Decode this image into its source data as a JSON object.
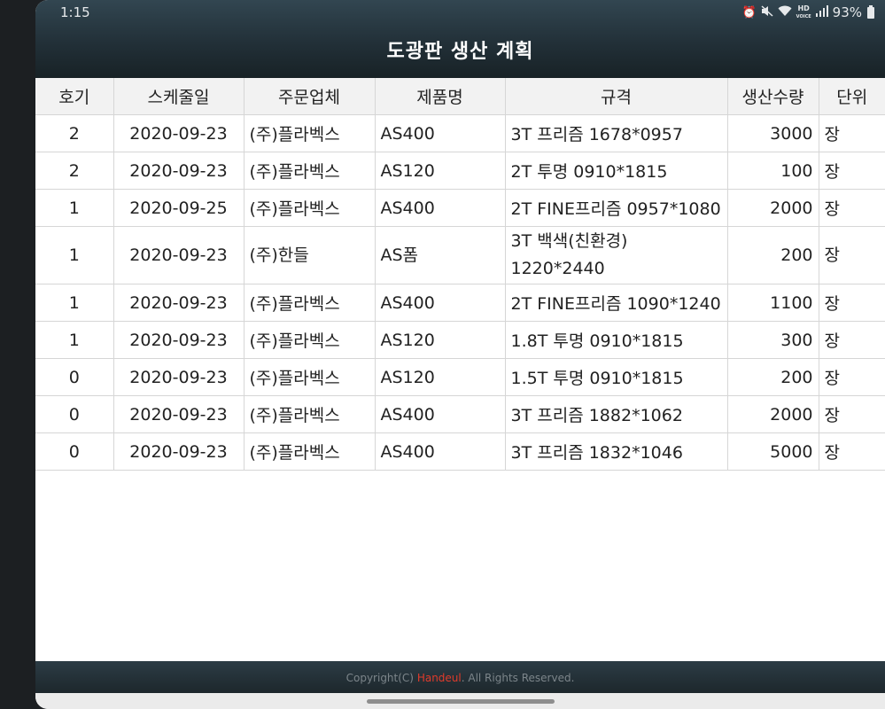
{
  "status": {
    "time": "1:15",
    "battery": "93%",
    "icons": [
      "alarm-icon",
      "mute-icon",
      "wifi-icon",
      "hd-voice-icon",
      "signal-icon",
      "battery-icon"
    ],
    "hd_top": "HD",
    "hd_bottom": "VOICE"
  },
  "header": {
    "title": "도광판 생산 계획"
  },
  "table": {
    "columns": [
      "호기",
      "스케줄일",
      "주문업체",
      "제품명",
      "규격",
      "생산수량",
      "단위"
    ],
    "rows": [
      {
        "machine": "2",
        "date": "2020-09-23",
        "company": "(주)플라벡스",
        "product": "AS400",
        "spec": "3T 프리즘 1678*0957",
        "qty": "3000",
        "unit": "장"
      },
      {
        "machine": "2",
        "date": "2020-09-23",
        "company": "(주)플라벡스",
        "product": "AS120",
        "spec": "2T 투명 0910*1815",
        "qty": "100",
        "unit": "장"
      },
      {
        "machine": "1",
        "date": "2020-09-25",
        "company": "(주)플라벡스",
        "product": "AS400",
        "spec": "2T FINE프리즘 0957*1080",
        "qty": "2000",
        "unit": "장"
      },
      {
        "machine": "1",
        "date": "2020-09-23",
        "company": "(주)한들",
        "product": "AS폼",
        "spec": "3T 백색(친환경) 1220*2440",
        "qty": "200",
        "unit": "장"
      },
      {
        "machine": "1",
        "date": "2020-09-23",
        "company": "(주)플라벡스",
        "product": "AS400",
        "spec": "2T FINE프리즘 1090*1240",
        "qty": "1100",
        "unit": "장"
      },
      {
        "machine": "1",
        "date": "2020-09-23",
        "company": "(주)플라벡스",
        "product": "AS120",
        "spec": "1.8T 투명 0910*1815",
        "qty": "300",
        "unit": "장"
      },
      {
        "machine": "0",
        "date": "2020-09-23",
        "company": "(주)플라벡스",
        "product": "AS120",
        "spec": "1.5T 투명 0910*1815",
        "qty": "200",
        "unit": "장"
      },
      {
        "machine": "0",
        "date": "2020-09-23",
        "company": "(주)플라벡스",
        "product": "AS400",
        "spec": "3T 프리즘 1882*1062",
        "qty": "2000",
        "unit": "장"
      },
      {
        "machine": "0",
        "date": "2020-09-23",
        "company": "(주)플라벡스",
        "product": "AS400",
        "spec": "3T 프리즘 1832*1046",
        "qty": "5000",
        "unit": "장"
      }
    ]
  },
  "footer": {
    "prefix": "Copyright(C) ",
    "brand": "Handeul",
    "suffix": ". All Rights Reserved.",
    "brand_color": "#e03b2b"
  },
  "colors": {
    "header_bg": "#223038",
    "table_header_bg": "#f2f2f2",
    "border": "#d6d6d6"
  }
}
